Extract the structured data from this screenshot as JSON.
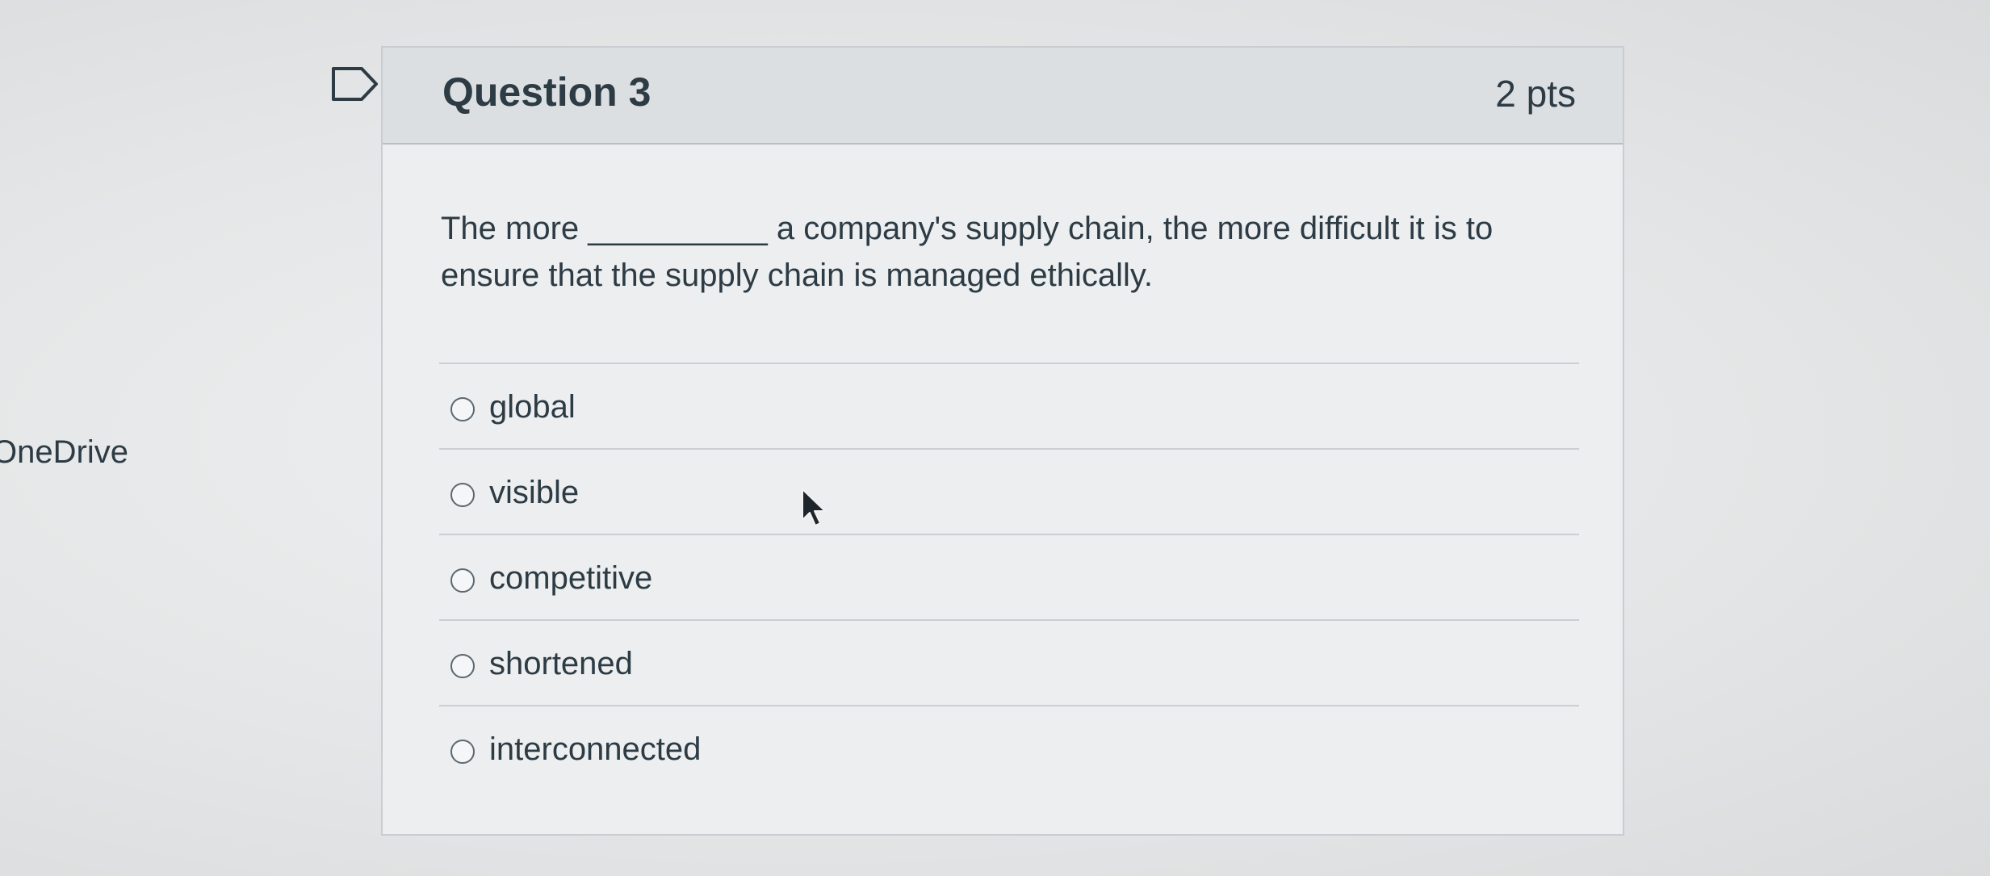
{
  "side": {
    "label": "OneDrive"
  },
  "question": {
    "title": "Question 3",
    "points": "2 pts",
    "text": "The more __________ a company's supply chain, the more difficult it is to ensure that the supply chain is managed ethically.",
    "answers": [
      {
        "label": "global",
        "selected": false
      },
      {
        "label": "visible",
        "selected": false
      },
      {
        "label": "competitive",
        "selected": false
      },
      {
        "label": "shortened",
        "selected": false
      },
      {
        "label": "interconnected",
        "selected": false
      }
    ]
  },
  "icons": {
    "flag": "bookmark-flag-icon",
    "cursor": "mouse-pointer-icon"
  }
}
